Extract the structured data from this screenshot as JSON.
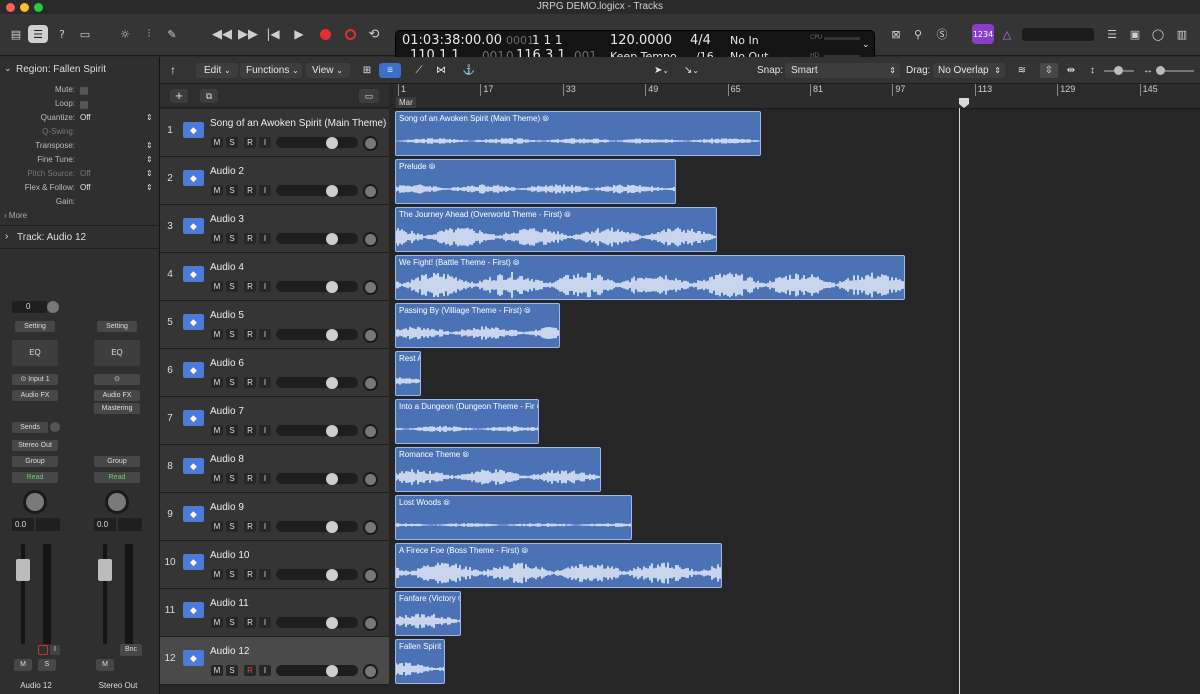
{
  "window": {
    "title": "JRPG DEMO.logicx - Tracks"
  },
  "lcd": {
    "position_time": "01:03:38:00.00",
    "position_bars_top": "1 1 1",
    "position_bars_top_dim": "0001",
    "position_bars": "110  1  1",
    "position_bars_dim": "001",
    "end_dim": "0",
    "end_bars": "116  3  1",
    "end_bars_tail": "001",
    "tempo": "120.0000",
    "tempo_mode": "Keep Tempo",
    "signature": "4/4",
    "division": "/16",
    "in_label": "No In",
    "out_label": "No Out",
    "cpu_label": "CPU",
    "hd_label": "HD"
  },
  "counter_badge": "1234",
  "inspector": {
    "region_header": "Region: Fallen Spirit",
    "rows": [
      {
        "label": "Mute:",
        "value": ""
      },
      {
        "label": "Loop:",
        "value": ""
      },
      {
        "label": "Quantize:",
        "value": "Off"
      },
      {
        "label": "Q-Swing:",
        "value": ""
      },
      {
        "label": "Transpose:",
        "value": ""
      },
      {
        "label": "Fine Tune:",
        "value": ""
      },
      {
        "label": "Pitch Source:",
        "value": "Off"
      },
      {
        "label": "Flex & Follow:",
        "value": "Off"
      },
      {
        "label": "Gain:",
        "value": ""
      }
    ],
    "more_label": "More",
    "track_header": "Track:  Audio 12",
    "strip1": {
      "value": "0",
      "setting": "Setting",
      "eq": "EQ",
      "input": "Input 1",
      "audio_fx": "Audio FX",
      "sends": "Sends",
      "output": "Stereo Out",
      "group": "Group",
      "automation": "Read",
      "vol": "0.0",
      "mute": "M",
      "solo": "S",
      "name": "Audio 12"
    },
    "strip2": {
      "setting": "Setting",
      "eq": "EQ",
      "audio_fx": "Audio FX",
      "plugin": "Mastering",
      "group": "Group",
      "automation": "Read",
      "vol": "0.0",
      "mute": "M",
      "bnc": "Bnc",
      "name": "Stereo Out"
    }
  },
  "toolbar": {
    "edit": "Edit",
    "functions": "Functions",
    "view": "View",
    "snap_label": "Snap:",
    "snap_value": "Smart",
    "drag_label": "Drag:",
    "drag_value": "No Overlap"
  },
  "ruler": {
    "marker": "Mar",
    "bars": [
      "1",
      "17",
      "33",
      "49",
      "65",
      "81",
      "97",
      "113",
      "129",
      "145"
    ]
  },
  "track_buttons": {
    "m": "M",
    "s": "S",
    "r": "R",
    "i": "I"
  },
  "tracks": [
    {
      "num": "1",
      "name": "Song of an Awoken Spirit (Main Theme)",
      "region": "Song of an Awoken Spirit (Main Theme)",
      "start": 1,
      "end": 72
    },
    {
      "num": "2",
      "name": "Audio 2",
      "region": "Prelude",
      "start": 1,
      "end": 55.5
    },
    {
      "num": "3",
      "name": "Audio 3",
      "region": "The Journey Ahead (Overworld Theme - First)",
      "start": 1,
      "end": 63.5
    },
    {
      "num": "4",
      "name": "Audio 4",
      "region": "We Fight! (Battle Theme - First)",
      "start": 1,
      "end": 100
    },
    {
      "num": "5",
      "name": "Audio 5",
      "region": "Passing By (Villiage Theme - First)",
      "start": 1,
      "end": 33
    },
    {
      "num": "6",
      "name": "Audio 6",
      "region": "Rest A",
      "start": 1,
      "end": 6
    },
    {
      "num": "7",
      "name": "Audio 7",
      "region": "Into a Dungeon (Dungeon Theme - Fir",
      "start": 1,
      "end": 29
    },
    {
      "num": "8",
      "name": "Audio 8",
      "region": "Romance Theme",
      "start": 1,
      "end": 41
    },
    {
      "num": "9",
      "name": "Audio 9",
      "region": "Lost Woods",
      "start": 1,
      "end": 47
    },
    {
      "num": "10",
      "name": "Audio 10",
      "region": "A Firece Foe (Boss Theme - First)",
      "start": 1,
      "end": 64.5
    },
    {
      "num": "11",
      "name": "Audio 11",
      "region": "Fanfare (Victory",
      "start": 1,
      "end": 13.8
    },
    {
      "num": "12",
      "name": "Audio 12",
      "region": "Fallen Spirit",
      "start": 1,
      "end": 10.8
    }
  ],
  "playhead_bar": 110
}
